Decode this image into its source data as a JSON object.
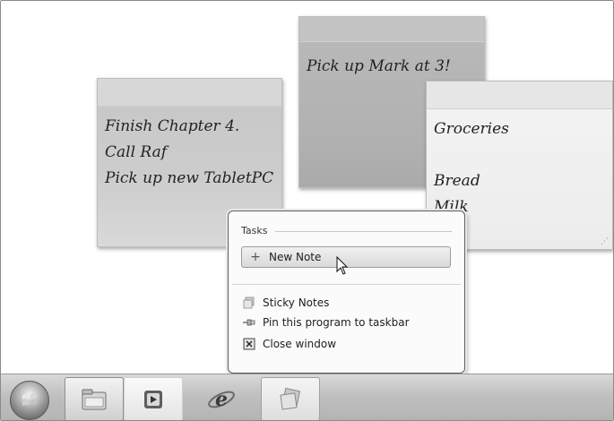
{
  "notes": [
    {
      "lines": [
        "Finish Chapter 4.",
        "Call Raf",
        "Pick up new TabletPC"
      ]
    },
    {
      "lines": [
        "Pick up Mark at 3!"
      ]
    },
    {
      "lines": [
        "Groceries",
        "",
        "Bread",
        "Milk"
      ]
    }
  ],
  "jumplist": {
    "header": "Tasks",
    "new_note": "New Note",
    "items": {
      "sticky_notes": "Sticky Notes",
      "pin": "Pin this program to taskbar",
      "close": "Close window"
    }
  },
  "icons": {
    "new_note": "plus-icon",
    "sticky_notes": "sticky-notes-icon",
    "pin": "pin-icon",
    "close": "close-window-icon",
    "start": "windows-start-orb",
    "explorer": "folder-icon",
    "media": "media-player-icon",
    "ie": "internet-explorer-icon",
    "sticky_app": "sticky-notes-app-icon"
  },
  "colors": {
    "note_dark": "#b1b1b1",
    "note_mid": "#cdcdcd",
    "note_light": "#efefef",
    "taskbar": "#bfbfbf"
  }
}
